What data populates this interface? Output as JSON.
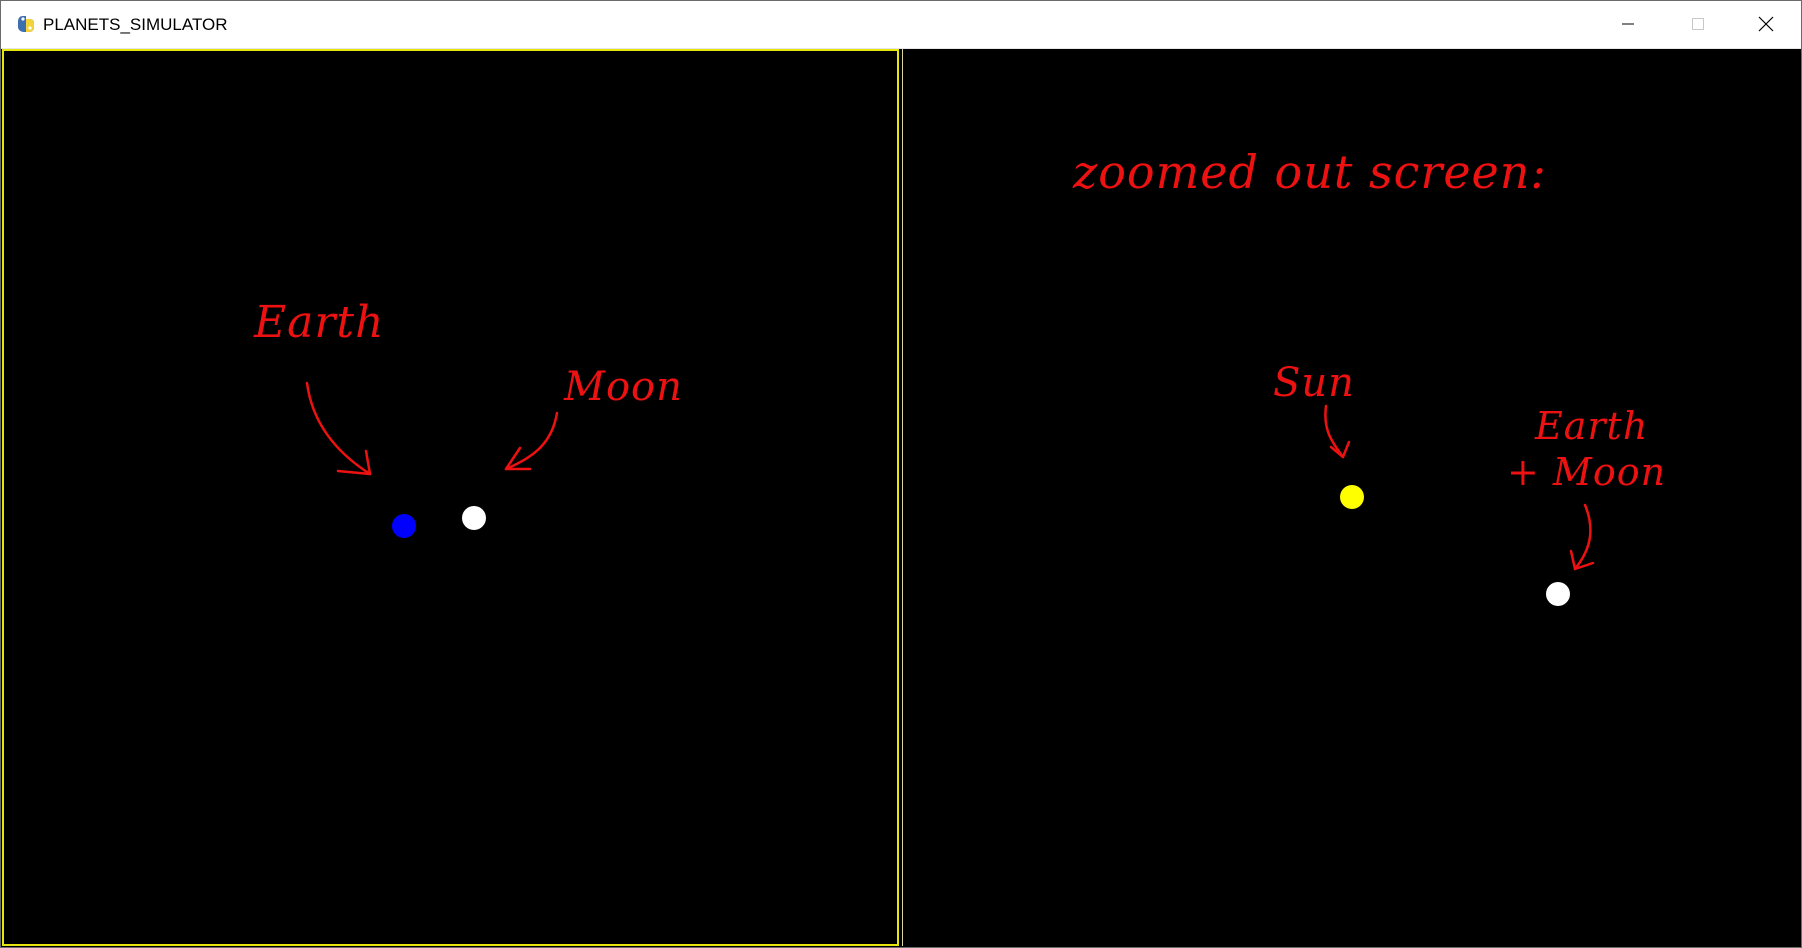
{
  "window": {
    "title": "PLANETS_SIMULATOR",
    "icon": "pygame-snake-icon",
    "controls": {
      "minimize_icon": "minimize-icon",
      "maximize_icon": "maximize-icon",
      "close_icon": "close-icon"
    }
  },
  "colors": {
    "background": "#000000",
    "panel_border": "#e5e50f",
    "earth": "#0000ff",
    "moon": "#ffffff",
    "sun": "#ffff00",
    "annotation": "#ee1111"
  },
  "left_panel": {
    "annotations": {
      "earth": "Earth",
      "moon": "Moon"
    }
  },
  "right_panel": {
    "annotations": {
      "heading": "zoomed out screen:",
      "sun": "Sun",
      "earth_moon_line1": "Earth",
      "earth_moon_line2": "+ Moon"
    }
  }
}
